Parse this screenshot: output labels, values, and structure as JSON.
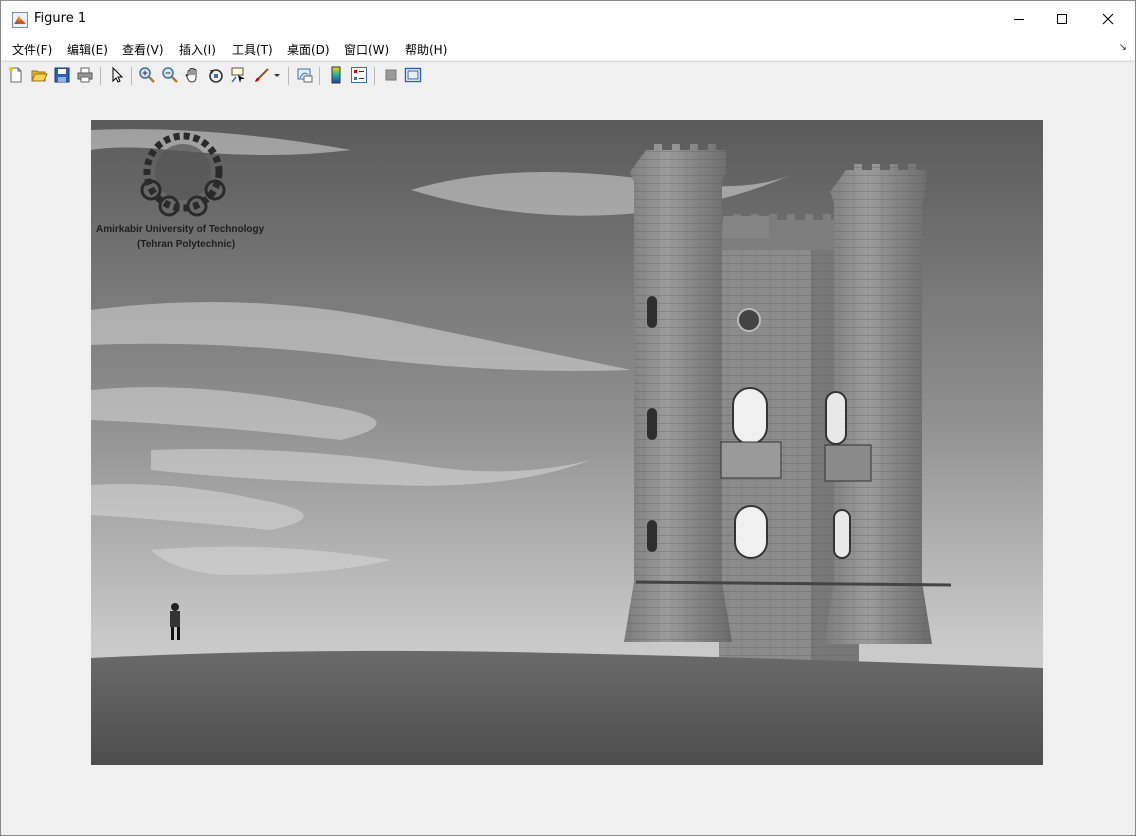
{
  "window": {
    "title": "Figure 1",
    "controls": {
      "minimize": "minimize",
      "maximize": "maximize",
      "close": "close"
    }
  },
  "menubar": {
    "items": [
      "文件(F)",
      "编辑(E)",
      "查看(V)",
      "插入(I)",
      "工具(T)",
      "桌面(D)",
      "窗口(W)",
      "帮助(H)"
    ]
  },
  "toolbar": {
    "icons": [
      "new-figure-icon",
      "open-file-icon",
      "save-icon",
      "print-icon",
      "pointer-icon",
      "zoom-in-icon",
      "zoom-out-icon",
      "pan-icon",
      "rotate-3d-icon",
      "data-cursor-icon",
      "brush-icon",
      "link-plot-icon",
      "colorbar-icon",
      "legend-icon",
      "hide-plot-tools-icon",
      "show-plot-tools-icon"
    ]
  },
  "figure": {
    "logo_text": {
      "line1": "Amirkabir University of Technology",
      "line2": "(Tehran Polytechnic)"
    }
  },
  "colors": {
    "window_bg": "#f0f0f0",
    "titlebar_bg": "#ffffff",
    "matlab_orange": "#d9541e"
  }
}
